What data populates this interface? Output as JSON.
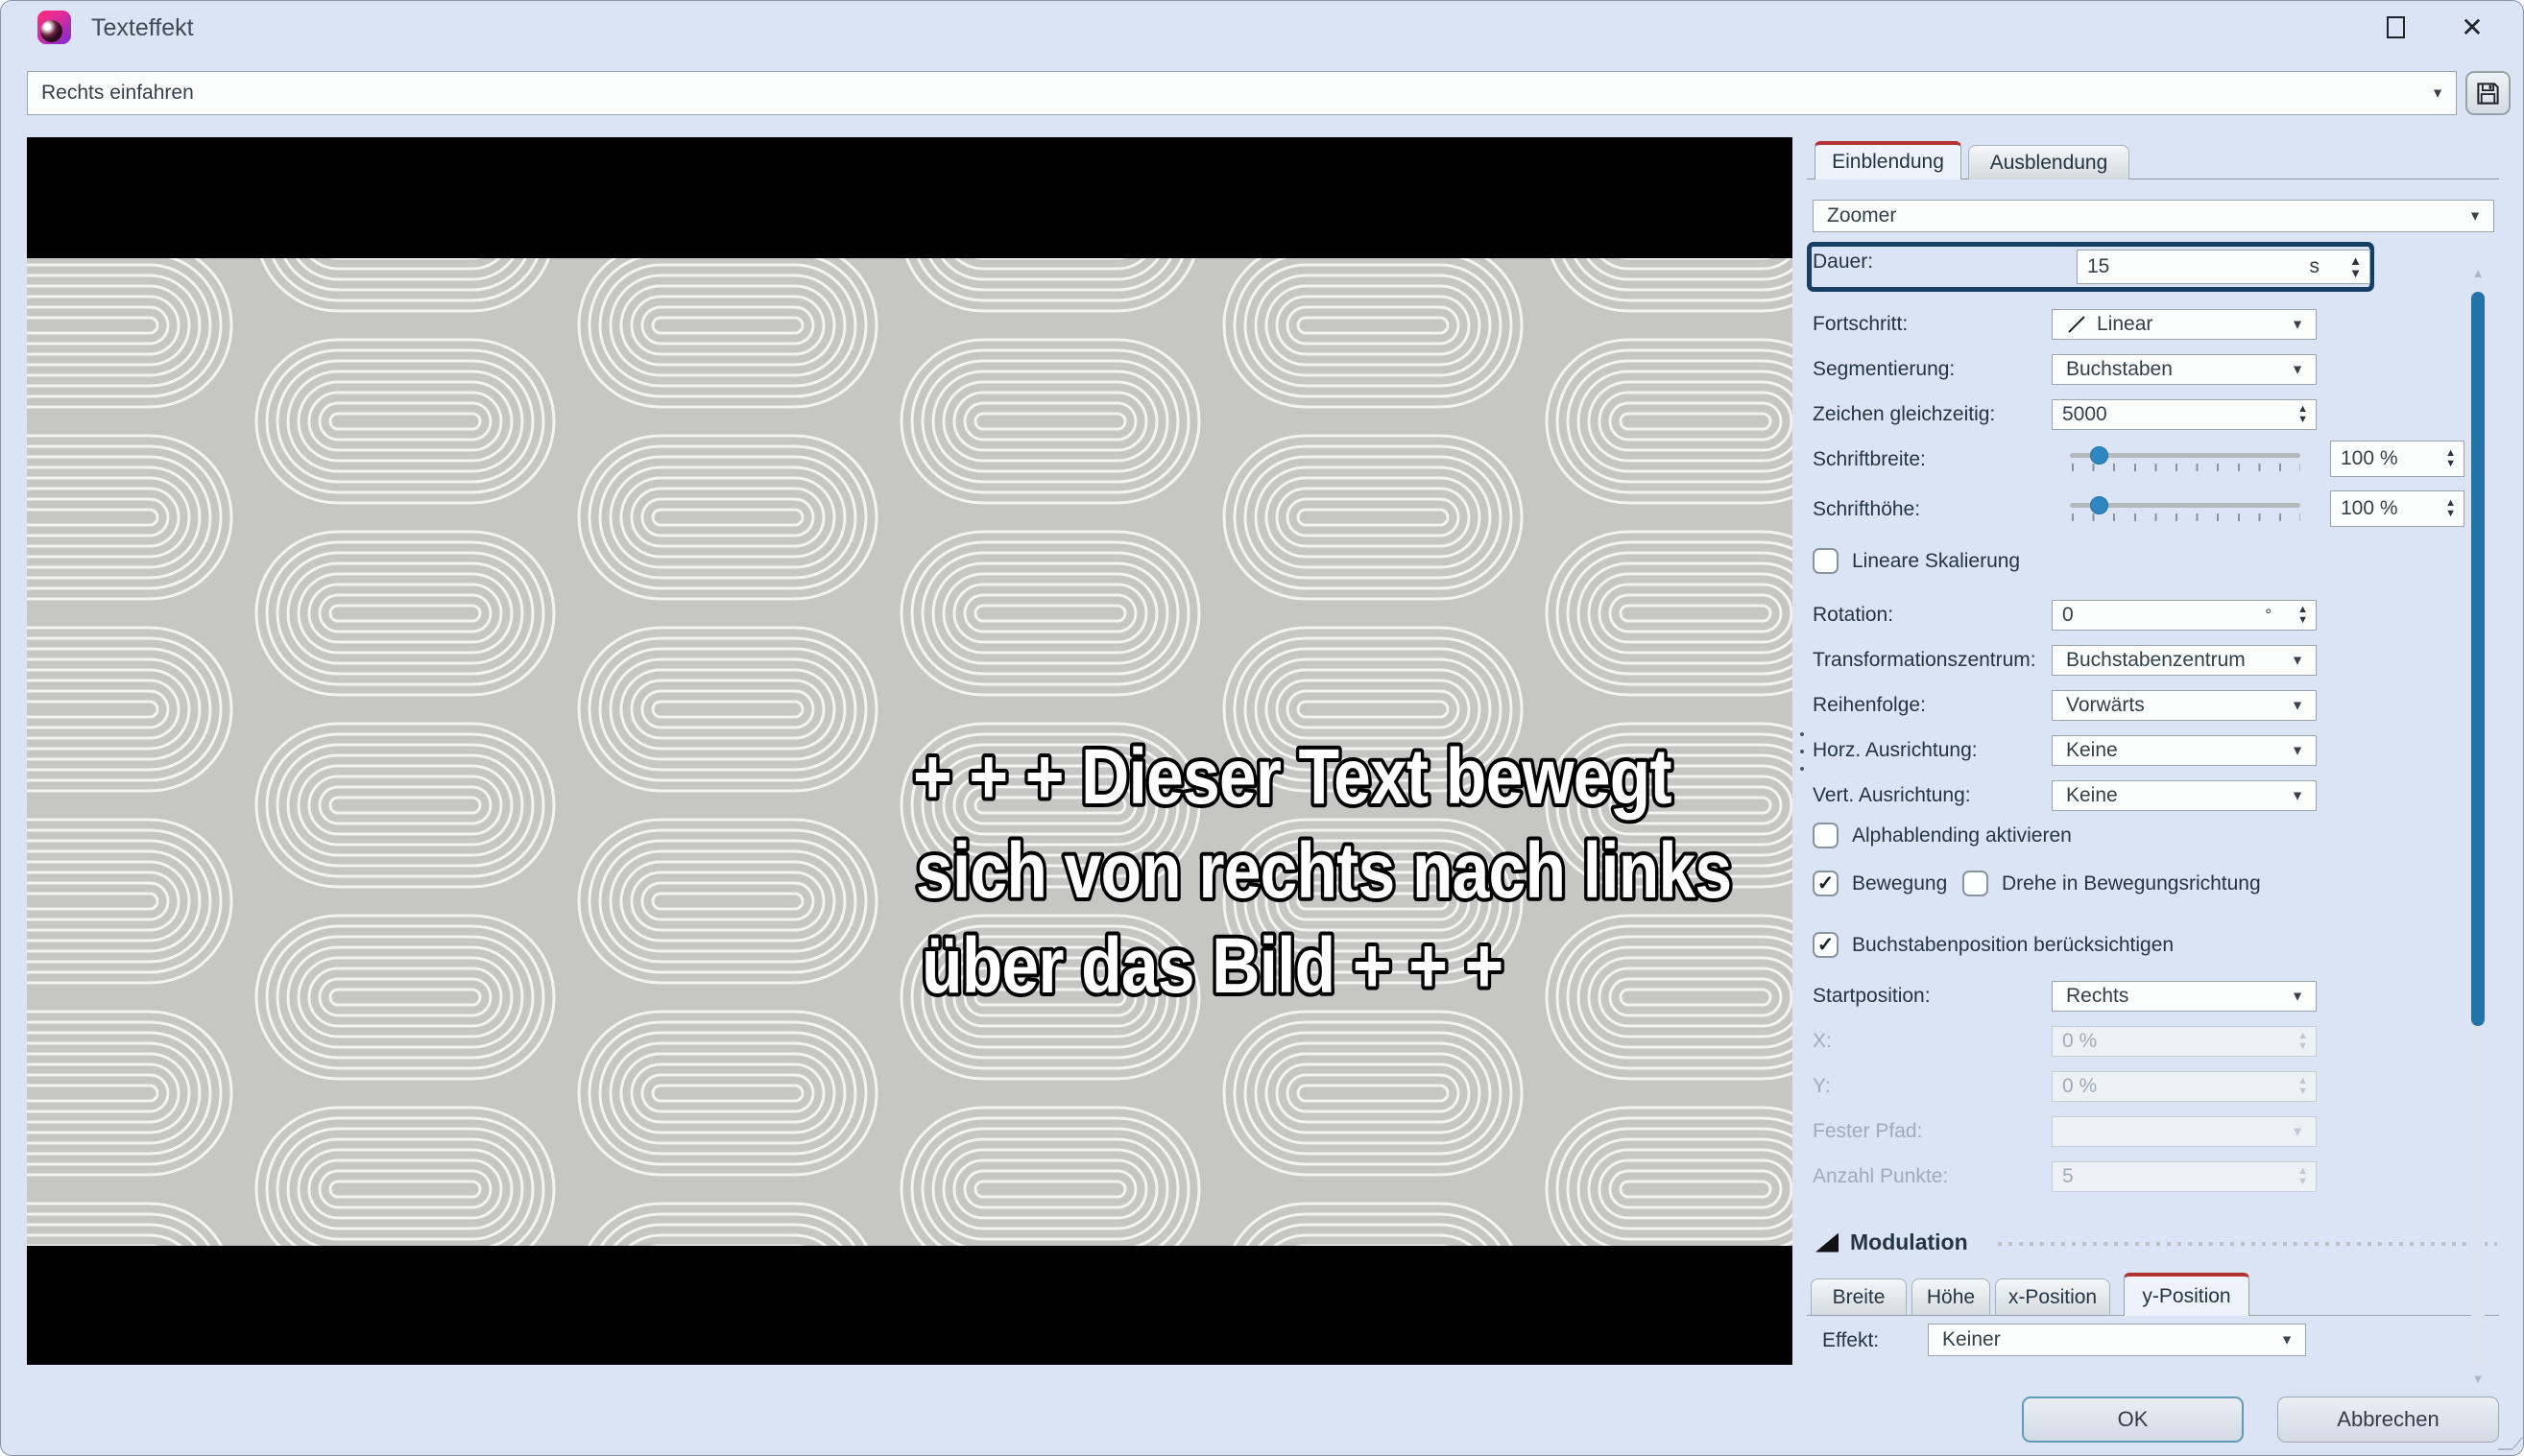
{
  "window": {
    "title": "Texteffekt"
  },
  "icons": {
    "app": "texteffekt-logo",
    "save": "floppy-disk",
    "maximize": "maximize-square",
    "close": "✕",
    "combo_arrow": "▼",
    "spin_up": "▲",
    "spin_down": "▼",
    "scroll_up": "▲",
    "scroll_down": "▼",
    "check": "✓",
    "fortschritt_icon": "diagonal-line",
    "modulation_collapse": "collapse-triangle"
  },
  "toolbar": {
    "preset_value": "Rechts einfahren"
  },
  "preview": {
    "lines": [
      "+ + + Dieser Text bewegt",
      "sich von rechts nach links",
      "über das Bild + + +"
    ],
    "pattern_bg": "#c6c6c4",
    "pattern_line": "#f3f3f1"
  },
  "panel": {
    "tabs": [
      {
        "label": "Einblendung",
        "active": true
      },
      {
        "label": "Ausblendung",
        "active": false
      }
    ],
    "effect_select": "Zoomer",
    "dauer": {
      "label": "Dauer:",
      "value": "15",
      "unit": "s"
    },
    "rows": {
      "fortschritt": {
        "label": "Fortschritt:",
        "value": "Linear"
      },
      "segmentierung": {
        "label": "Segmentierung:",
        "value": "Buchstaben"
      },
      "zeichen": {
        "label": "Zeichen gleichzeitig:",
        "value": "5000"
      },
      "schriftbreite": {
        "label": "Schriftbreite:",
        "value": "100 %",
        "slider_pos_pct": 12.5
      },
      "schrifthoehe": {
        "label": "Schrifthöhe:",
        "value": "100 %",
        "slider_pos_pct": 12.5
      },
      "lineare_skalierung": {
        "label": "Lineare Skalierung",
        "checked": false
      },
      "rotation": {
        "label": "Rotation:",
        "value": "0",
        "unit": "°"
      },
      "transformationszentrum": {
        "label": "Transformationszentrum:",
        "value": "Buchstabenzentrum"
      },
      "reihenfolge": {
        "label": "Reihenfolge:",
        "value": "Vorwärts"
      },
      "horz": {
        "label": "Horz. Ausrichtung:",
        "value": "Keine"
      },
      "vert": {
        "label": "Vert. Ausrichtung:",
        "value": "Keine"
      },
      "alphablending": {
        "label": "Alphablending aktivieren",
        "checked": false
      },
      "bewegung": {
        "label": "Bewegung",
        "checked": true
      },
      "drehe": {
        "label": "Drehe in Bewegungsrichtung",
        "checked": false
      },
      "buchstabenposition": {
        "label": "Buchstabenposition berücksichtigen",
        "checked": true
      },
      "startposition": {
        "label": "Startposition:",
        "value": "Rechts"
      },
      "x": {
        "label": "X:",
        "value": "0 %",
        "disabled": true
      },
      "y": {
        "label": "Y:",
        "value": "0 %",
        "disabled": true
      },
      "fester_pfad": {
        "label": "Fester Pfad:",
        "value": "",
        "disabled": true
      },
      "anzahl_punkte": {
        "label": "Anzahl Punkte:",
        "value": "5",
        "disabled": true
      }
    },
    "modulation": {
      "title": "Modulation",
      "tabs": [
        {
          "label": "Breite",
          "active": false
        },
        {
          "label": "Höhe",
          "active": false
        },
        {
          "label": "x-Position",
          "active": false
        },
        {
          "label": "y-Position",
          "active": true
        }
      ],
      "effekt": {
        "label": "Effekt:",
        "value": "Keiner"
      }
    },
    "buttons": {
      "ok": "OK",
      "cancel": "Abbrechen"
    }
  },
  "colors": {
    "window_bg": "#dbe4f4",
    "accent_red": "#b23434",
    "focus_navy": "#173f66",
    "scroll_blue": "#2273a8",
    "slider_blue": "#2f86c0"
  }
}
